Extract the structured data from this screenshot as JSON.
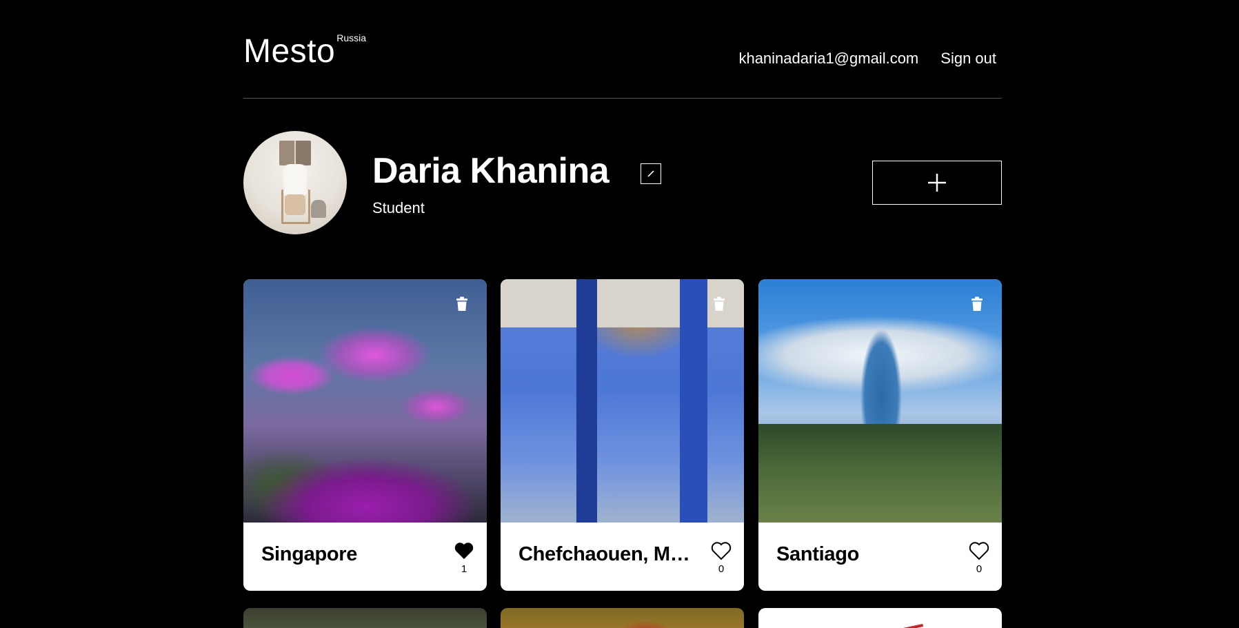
{
  "header": {
    "logo": "Mesto",
    "logo_sub": "Russia",
    "email": "khaninadaria1@gmail.com",
    "signout_label": "Sign out"
  },
  "profile": {
    "name": "Daria Khanina",
    "about": "Student",
    "edit_icon": "pencil-icon",
    "add_icon": "plus-icon"
  },
  "cards": [
    {
      "title": "Singapore",
      "likes": "1",
      "liked": true,
      "image": "Gardens by the Bay supertrees at dusk"
    },
    {
      "title": "Chefchaouen, Morocco",
      "likes": "0",
      "liked": false,
      "image": "blue painted street"
    },
    {
      "title": "Santiago",
      "likes": "0",
      "liked": false,
      "image": "city skyline with snowy mountains"
    }
  ],
  "icons": {
    "trash": "trash-icon",
    "like": "heart-icon"
  },
  "colors": {
    "background": "#000000",
    "card": "#ffffff",
    "divider": "#545454"
  }
}
